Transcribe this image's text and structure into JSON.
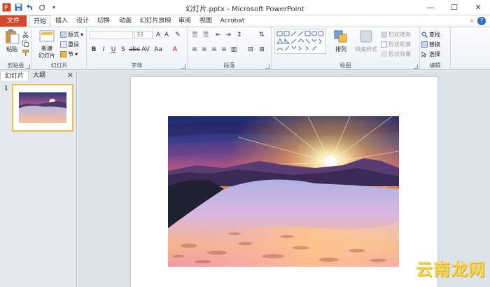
{
  "window": {
    "title": "幻灯片.pptx - Microsoft PowerPoint",
    "minimize": "—",
    "maximize": "☐",
    "close": "✕"
  },
  "qat": {
    "save": "save-icon",
    "undo": "undo-icon",
    "redo": "redo-icon",
    "customize": "▾"
  },
  "tabs": [
    {
      "label": "文件"
    },
    {
      "label": "开始"
    },
    {
      "label": "插入"
    },
    {
      "label": "设计"
    },
    {
      "label": "切换"
    },
    {
      "label": "动画"
    },
    {
      "label": "幻灯片放映"
    },
    {
      "label": "审阅"
    },
    {
      "label": "视图"
    },
    {
      "label": "Acrobat"
    }
  ],
  "ribbon": {
    "clipboard": {
      "label": "剪贴板",
      "paste": "粘贴"
    },
    "slides": {
      "label": "幻灯片",
      "new_slide": "新建\n幻灯片",
      "layout": "版式",
      "reset": "重设",
      "section": "节"
    },
    "font": {
      "label": "字体",
      "font_name": "",
      "font_size": "32"
    },
    "paragraph": {
      "label": "段落"
    },
    "drawing": {
      "label": "绘图",
      "arrange": "排列",
      "quick_styles": "快速样式",
      "shape_fill": "形状填充",
      "shape_outline": "形状轮廓",
      "shape_effects": "形状效果"
    },
    "editing": {
      "label": "编辑",
      "find": "查找",
      "replace": "替换",
      "select": "选择"
    }
  },
  "panel": {
    "tab_slides": "幻灯片",
    "tab_outline": "大纲",
    "close": "✕",
    "slide_number": "1"
  },
  "watermark": "云南龙网"
}
